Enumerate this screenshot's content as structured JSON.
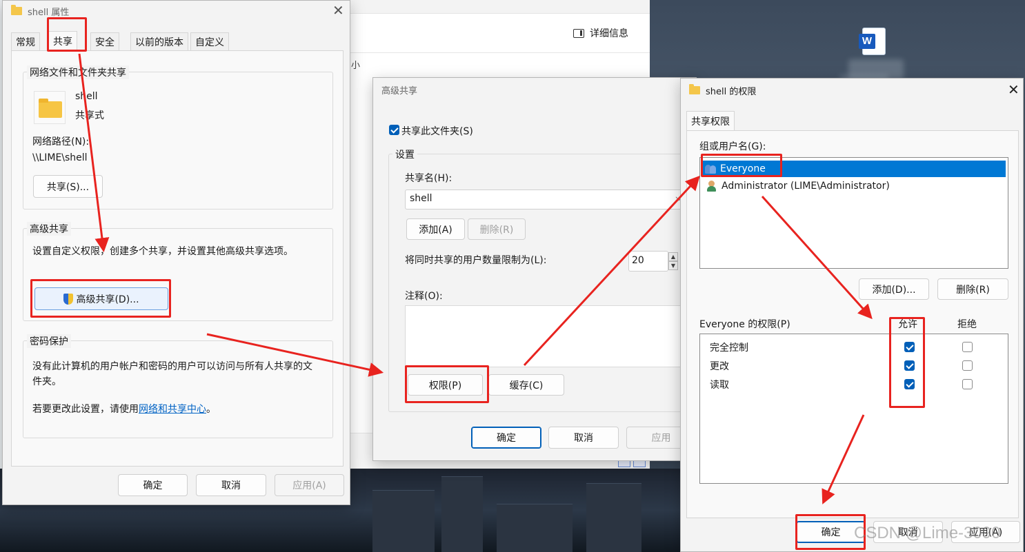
{
  "explorer": {
    "details_label": "详细信息",
    "size_col": "小"
  },
  "props": {
    "title": "shell 属性",
    "tabs": [
      "常规",
      "共享",
      "安全",
      "以前的版本",
      "自定义"
    ],
    "net_group": "网络文件和文件夹共享",
    "folder_name": "shell",
    "folder_state": "共享式",
    "net_path_label": "网络路径(N):",
    "net_path": "\\\\LIME\\shell",
    "share_btn": "共享(S)...",
    "adv_group": "高级共享",
    "adv_desc": "设置自定义权限，创建多个共享，并设置其他高级共享选项。",
    "adv_btn": "高级共享(D)...",
    "pwd_group": "密码保护",
    "pwd_desc1": "没有此计算机的用户帐户和密码的用户可以访问与所有人共享的文",
    "pwd_desc2": "件夹。",
    "pwd_change_prefix": "若要更改此设置，请使用",
    "pwd_link": "网络和共享中心",
    "pwd_change_suffix": "。",
    "ok": "确定",
    "cancel": "取消",
    "apply": "应用(A)"
  },
  "advanced": {
    "title": "高级共享",
    "share_checkbox": "共享此文件夹(S)",
    "share_checked": true,
    "settings_group": "设置",
    "share_name_label": "共享名(H):",
    "share_name": "shell",
    "add_btn": "添加(A)",
    "remove_btn": "删除(R)",
    "limit_label": "将同时共享的用户数量限制为(L):",
    "limit_value": "20",
    "comment_label": "注释(O):",
    "perm_btn": "权限(P)",
    "cache_btn": "缓存(C)",
    "ok": "确定",
    "cancel": "取消",
    "apply": "应用"
  },
  "perms": {
    "title": "shell 的权限",
    "tab": "共享权限",
    "users_label": "组或用户名(G):",
    "users": [
      {
        "name": "Everyone",
        "icon": "users-icon",
        "selected": true
      },
      {
        "name": "Administrator (LIME\\Administrator)",
        "icon": "user-icon",
        "selected": false
      }
    ],
    "add_btn": "添加(D)...",
    "remove_btn": "删除(R)",
    "perm_label": "Everyone 的权限(P)",
    "allow_col": "允许",
    "deny_col": "拒绝",
    "rows": [
      {
        "name": "完全控制",
        "allow": true,
        "deny": false
      },
      {
        "name": "更改",
        "allow": true,
        "deny": false
      },
      {
        "name": "读取",
        "allow": true,
        "deny": false
      }
    ],
    "ok": "确定",
    "cancel": "取消",
    "apply": "应用(A)"
  },
  "watermark": "CSDN @Lime-3090",
  "colors": {
    "accent": "#005fb8",
    "annotation": "#e8231f",
    "selection": "#0078d4"
  }
}
